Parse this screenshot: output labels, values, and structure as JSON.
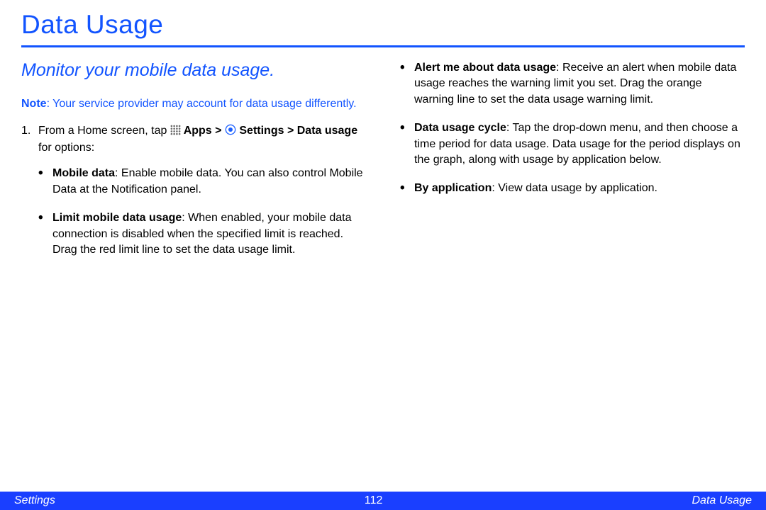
{
  "title": "Data Usage",
  "subtitle": "Monitor your mobile data usage.",
  "note_label": "Note",
  "note_text": ": Your service provider may account for data usage differently.",
  "step_number": "1.",
  "step_prefix": "From a Home screen, tap ",
  "step_apps": " Apps > ",
  "step_settings": " Settings > Data usage",
  "step_suffix": " for options:",
  "left_bullets": [
    {
      "label": "Mobile data",
      "text": ": Enable mobile data. You can also control Mobile Data at the Notification panel."
    },
    {
      "label": "Limit mobile data usage",
      "text": ": When enabled, your mobile data connection is disabled when the specified limit is reached. Drag the red limit line to set the data usage limit."
    }
  ],
  "right_bullets": [
    {
      "label": "Alert me about data usage",
      "text": ": Receive an alert when mobile data usage reaches the warning limit you set. Drag the orange warning line to set the data usage warning limit."
    },
    {
      "label": "Data usage cycle",
      "text": ": Tap the drop-down menu, and then choose a time period for data usage. Data usage for the period displays on the graph, along with usage by application below."
    },
    {
      "label": "By application",
      "text": ": View data usage by application."
    }
  ],
  "footer": {
    "left": "Settings",
    "page": "112",
    "right": "Data Usage"
  }
}
